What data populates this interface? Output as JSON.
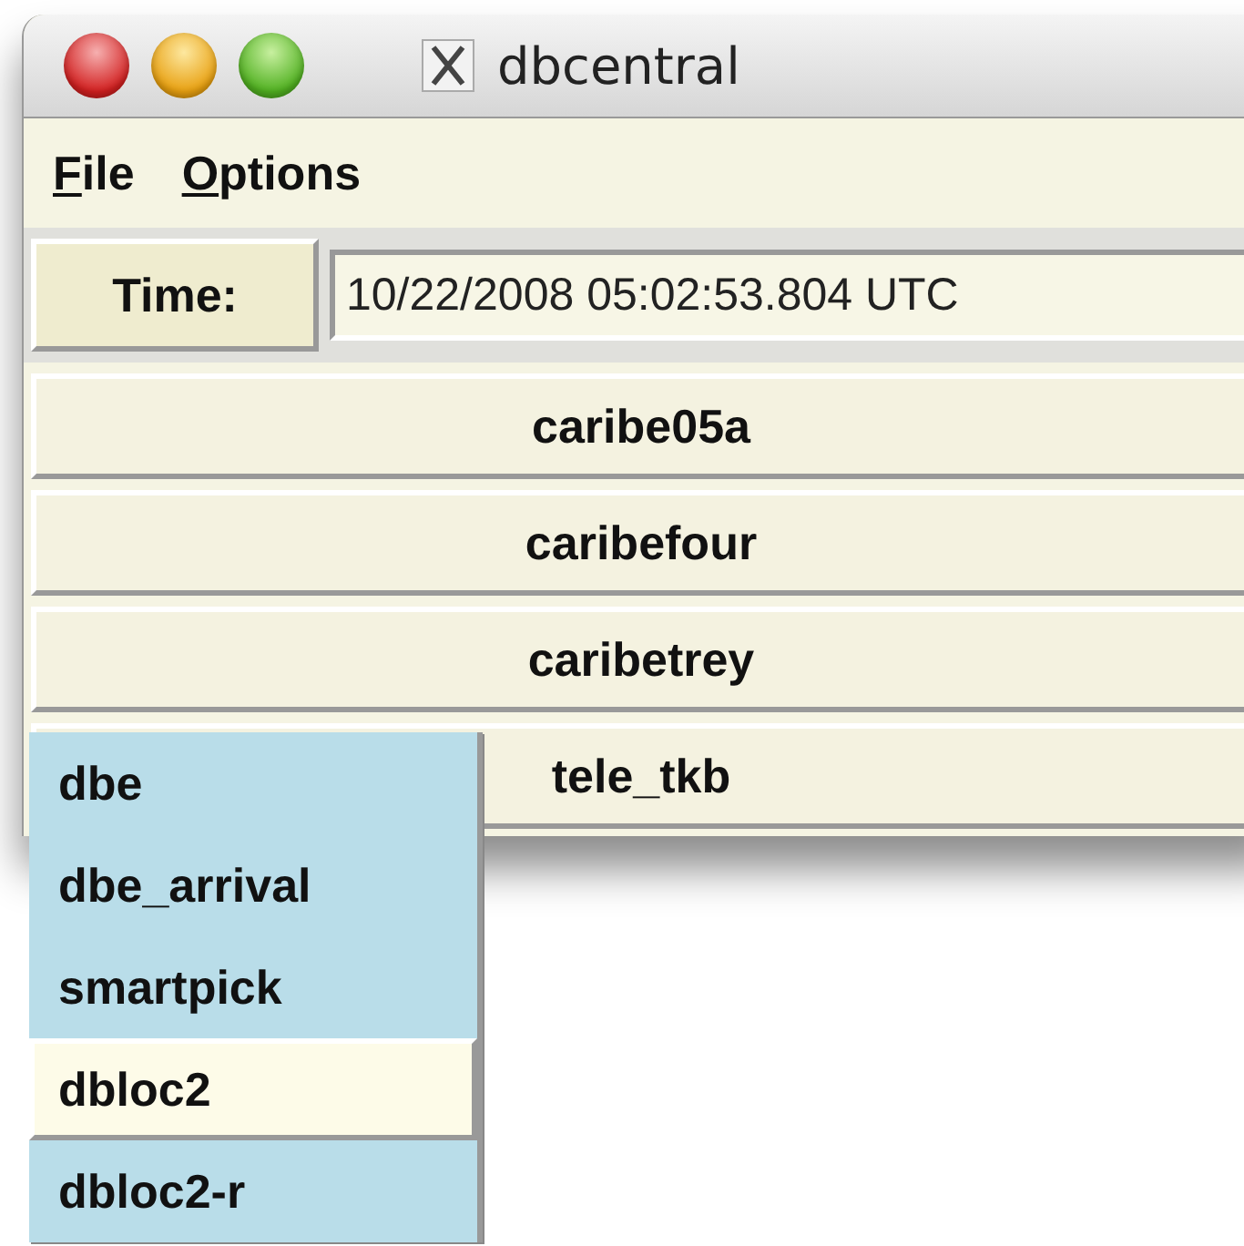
{
  "window": {
    "title": "dbcentral"
  },
  "menu": [
    {
      "label": "File"
    },
    {
      "label": "Options"
    }
  ],
  "time": {
    "button": "Time:",
    "value": "10/22/2008 05:02:53.804 UTC"
  },
  "buttons": [
    "caribe05a",
    "caribefour",
    "caribetrey",
    "tele_tkb"
  ],
  "popup": [
    {
      "label": "dbe",
      "selected": false
    },
    {
      "label": "dbe_arrival",
      "selected": false
    },
    {
      "label": "smartpick",
      "selected": false
    },
    {
      "label": "dbloc2",
      "selected": true
    },
    {
      "label": "dbloc2-r",
      "selected": false
    }
  ]
}
